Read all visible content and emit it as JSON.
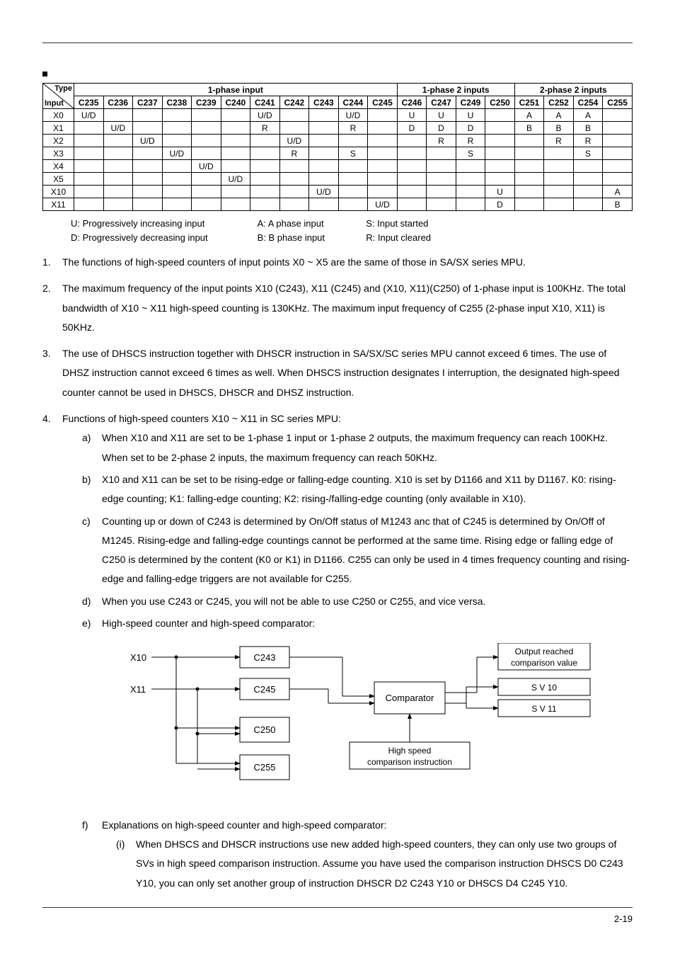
{
  "chart_data": {
    "type": "table",
    "diagonal_header": {
      "top": "Type",
      "bottom": "Input"
    },
    "column_groups": [
      {
        "label": "1-phase input",
        "span": 11
      },
      {
        "label": "1-phase 2 inputs",
        "span": 4
      },
      {
        "label": "2-phase 2 inputs",
        "span": 4
      }
    ],
    "columns": [
      "C235",
      "C236",
      "C237",
      "C238",
      "C239",
      "C240",
      "C241",
      "C242",
      "C243",
      "C244",
      "C245",
      "C246",
      "C247",
      "C249",
      "C250",
      "C251",
      "C252",
      "C254",
      "C255"
    ],
    "rows": [
      {
        "label": "X0",
        "cells": [
          "U/D",
          "",
          "",
          "",
          "",
          "",
          "U/D",
          "",
          "",
          "U/D",
          "",
          "U",
          "U",
          "U",
          "",
          "A",
          "A",
          "A",
          ""
        ]
      },
      {
        "label": "X1",
        "cells": [
          "",
          "U/D",
          "",
          "",
          "",
          "",
          "R",
          "",
          "",
          "R",
          "",
          "D",
          "D",
          "D",
          "",
          "B",
          "B",
          "B",
          ""
        ]
      },
      {
        "label": "X2",
        "cells": [
          "",
          "",
          "U/D",
          "",
          "",
          "",
          "",
          "U/D",
          "",
          "",
          "",
          "",
          "R",
          "R",
          "",
          "",
          "R",
          "R",
          ""
        ]
      },
      {
        "label": "X3",
        "cells": [
          "",
          "",
          "",
          "U/D",
          "",
          "",
          "",
          "R",
          "",
          "S",
          "",
          "",
          "",
          "S",
          "",
          "",
          "",
          "S",
          ""
        ]
      },
      {
        "label": "X4",
        "cells": [
          "",
          "",
          "",
          "",
          "U/D",
          "",
          "",
          "",
          "",
          "",
          "",
          "",
          "",
          "",
          "",
          "",
          "",
          "",
          ""
        ]
      },
      {
        "label": "X5",
        "cells": [
          "",
          "",
          "",
          "",
          "",
          "U/D",
          "",
          "",
          "",
          "",
          "",
          "",
          "",
          "",
          "",
          "",
          "",
          "",
          ""
        ]
      },
      {
        "label": "X10",
        "cells": [
          "",
          "",
          "",
          "",
          "",
          "",
          "",
          "",
          "U/D",
          "",
          "",
          "",
          "",
          "",
          "U",
          "",
          "",
          "",
          "A"
        ]
      },
      {
        "label": "X11",
        "cells": [
          "",
          "",
          "",
          "",
          "",
          "",
          "",
          "",
          "",
          "",
          "U/D",
          "",
          "",
          "",
          "D",
          "",
          "",
          "",
          "B"
        ]
      }
    ]
  },
  "legend": {
    "row1": {
      "c1": "U:  Progressively increasing input",
      "c2": "A:  A phase input",
      "c3": "S:  Input started"
    },
    "row2": {
      "c1": "D:  Progressively decreasing input",
      "c2": "B:  B phase input",
      "c3": "R:  Input cleared"
    }
  },
  "list": {
    "i1": "The functions of high-speed counters of input points X0 ~ X5 are the same of those in SA/SX series MPU.",
    "i2": "The maximum frequency of the input points X10 (C243), X11 (C245) and (X10, X11)(C250) of 1-phase input is 100KHz. The total bandwidth of X10 ~ X11 high-speed counting is 130KHz. The maximum input frequency of C255 (2-phase input X10, X11) is 50KHz.",
    "i3": "The use of DHSCS instruction together with DHSCR instruction in SA/SX/SC series MPU cannot exceed 6 times. The use of DHSZ instruction cannot exceed 6 times as well. When DHSCS instruction designates I interruption, the designated high-speed counter cannot be used in DHSCS, DHSCR and DHSZ instruction.",
    "i4": "Functions of high-speed counters X10 ~ X11 in SC series MPU:",
    "i4a": "When X10 and X11 are set to be 1-phase 1 input or 1-phase 2 outputs, the maximum frequency can reach 100KHz. When set to be 2-phase 2 inputs, the maximum frequency can reach 50KHz.",
    "i4b": "X10 and X11 can be set to be rising-edge or falling-edge counting. X10 is set by D1166 and X11 by D1167. K0: rising-edge counting; K1: falling-edge counting; K2: rising-/falling-edge counting (only available in X10).",
    "i4c": "Counting up or down of C243 is determined by On/Off status of M1243 anc that of C245 is determined by On/Off of M1245. Rising-edge and falling-edge countings cannot be performed at the same time. Rising edge or falling edge of C250 is determined by the content (K0 or K1) in D1166. C255 can only be used in 4 times frequency counting and rising-edge and falling-edge triggers are not available for C255.",
    "i4d": "When you use C243 or C245, you will not be able to use C250 or C255, and vice versa.",
    "i4e": "High-speed counter and high-speed comparator:",
    "i4f": "Explanations on high-speed counter and high-speed comparator:",
    "i4f_i": "When DHSCS and DHSCR instructions use new added high-speed counters, they can only use two groups of SVs in high speed comparison instruction. Assume you have used the comparison instruction DHSCS D0 C243 Y10, you can only set another group of instruction DHSCR D2 C243 Y10 or DHSCS D4 C245 Y10."
  },
  "diagram": {
    "x10": "X10",
    "x11": "X11",
    "c243": "C243",
    "c245": "C245",
    "c250": "C250",
    "c255": "C255",
    "comparator": "Comparator",
    "output": "Output reached\ncomparison value",
    "sv10": "S V 10",
    "sv11": "S V 11",
    "hs": "High speed\ncomparison instruction"
  },
  "page": "2-19"
}
